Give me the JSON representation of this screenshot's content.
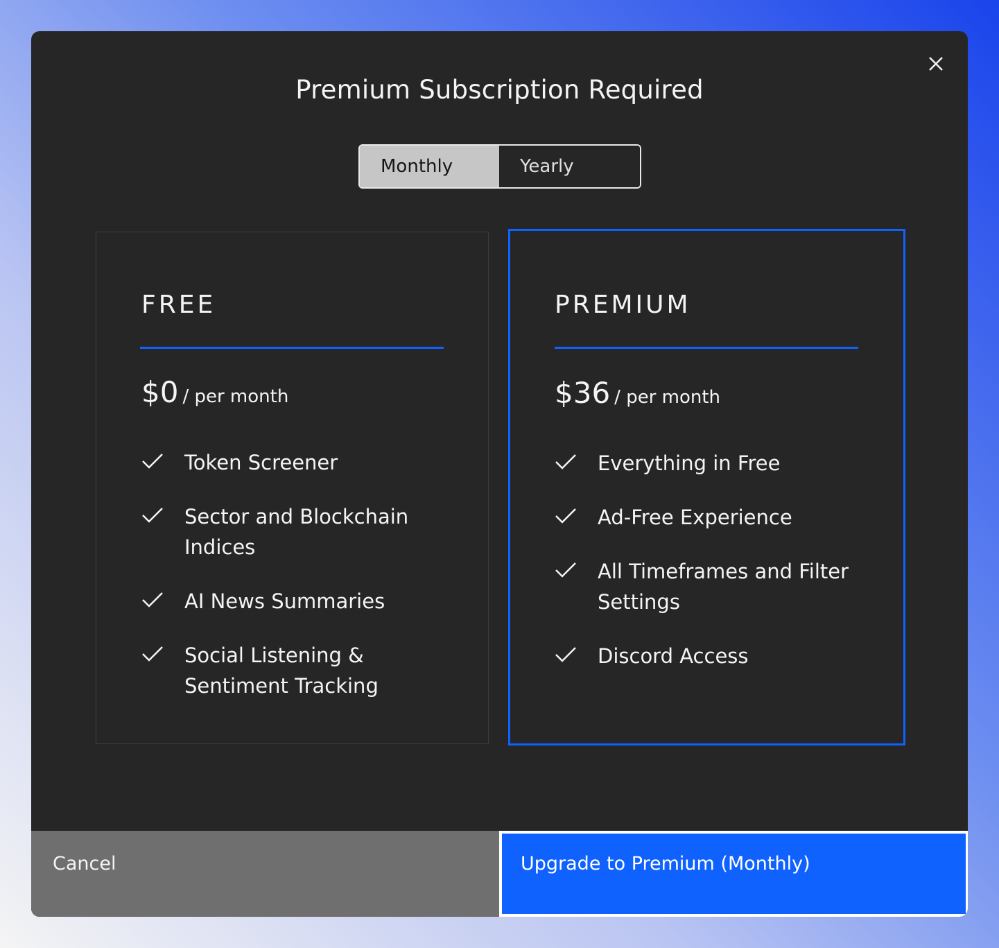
{
  "modal": {
    "title": "Premium Subscription Required",
    "close_icon": "close-icon"
  },
  "billing_toggle": {
    "options": [
      "Monthly",
      "Yearly"
    ],
    "selected": "Monthly"
  },
  "plans": [
    {
      "name": "FREE",
      "price": "$0",
      "period": "/ per month",
      "features": [
        "Token Screener",
        "Sector and Blockchain Indices",
        "AI News Summaries",
        "Social Listening & Sentiment Tracking"
      ]
    },
    {
      "name": "PREMIUM",
      "price": "$36",
      "period": "/ per month",
      "features": [
        "Everything in Free",
        "Ad-Free Experience",
        "All Timeframes and Filter Settings",
        "Discord Access"
      ]
    }
  ],
  "footer": {
    "cancel_label": "Cancel",
    "upgrade_label": "Upgrade to Premium (Monthly)"
  },
  "colors": {
    "accent": "#0f62fe",
    "modal_bg": "#262626",
    "cancel_bg": "#6f6f6f",
    "toggle_active_bg": "#c6c6c6"
  },
  "icons": {
    "check": "checkmark-icon",
    "close": "close-icon"
  }
}
